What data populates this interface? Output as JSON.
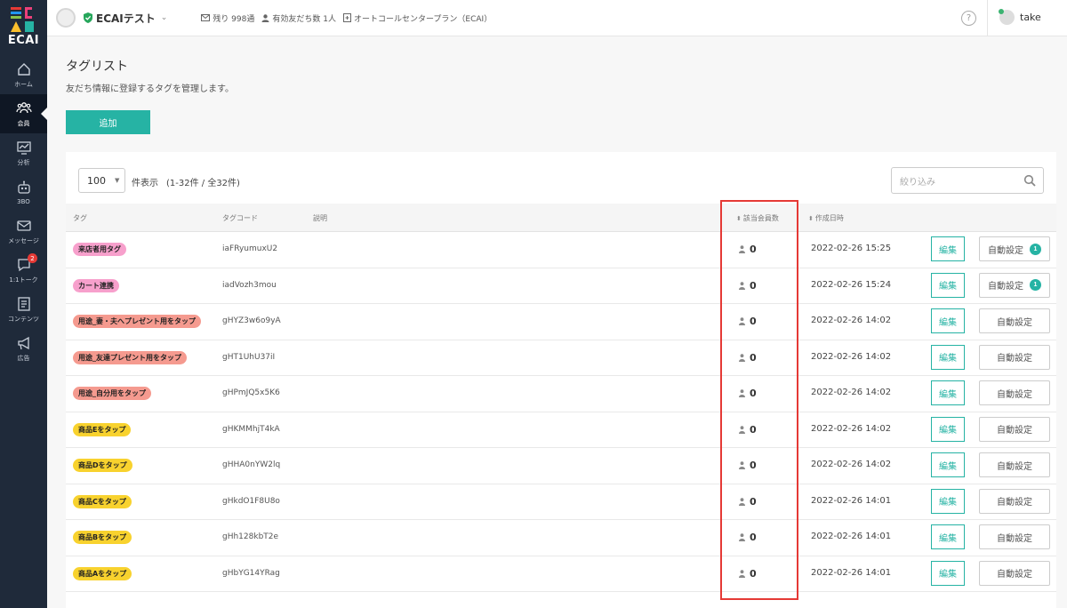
{
  "brand": {
    "logo_text": "ECAI",
    "colors": {
      "teal": "#26b3a4",
      "sidebar": "#1f2a3a",
      "highlight": "#e53935"
    }
  },
  "sidebar": {
    "items": [
      {
        "label": "ホーム",
        "icon": "home-icon"
      },
      {
        "label": "会員",
        "icon": "members-icon",
        "active": true
      },
      {
        "label": "分析",
        "icon": "analytics-icon"
      },
      {
        "label": "3BO",
        "icon": "robot-icon"
      },
      {
        "label": "メッセージ",
        "icon": "message-icon"
      },
      {
        "label": "1:1トーク",
        "icon": "chat-icon",
        "badge": "2"
      },
      {
        "label": "コンテンツ",
        "icon": "content-icon"
      },
      {
        "label": "広告",
        "icon": "megaphone-icon"
      }
    ]
  },
  "header": {
    "account_name": "ECAIテスト",
    "remaining": "残り 998通",
    "friends": "有効友だち数 1人",
    "plan": "オートコールセンタープラン（ECAI）",
    "help": "?",
    "user_name": "take"
  },
  "page": {
    "title": "タグリスト",
    "description": "友だち情報に登録するタグを管理します。",
    "add_label": "追加"
  },
  "table": {
    "per_page": "100",
    "per_page_label": "件表示",
    "count_label": "(1-32件 / 全32件)",
    "search_placeholder": "絞り込み",
    "headers": {
      "tag": "タグ",
      "code": "タグコード",
      "desc": "説明",
      "members": "該当会員数",
      "created": "作成日時"
    },
    "edit_label": "編集",
    "auto_label": "自動設定",
    "rows": [
      {
        "tag": "来店者用タグ",
        "color": "#f7a0cc",
        "code": "iaFRyumuxU2",
        "members": "0",
        "date": "2022-02-26 15:25",
        "auto_badge": "1"
      },
      {
        "tag": "カート連携",
        "color": "#f7a0cc",
        "code": "iadVozh3mou",
        "members": "0",
        "date": "2022-02-26 15:24",
        "auto_badge": "1"
      },
      {
        "tag": "用途_妻・夫へプレゼント用をタップ",
        "color": "#f59a8f",
        "code": "gHYZ3w6o9yA",
        "members": "0",
        "date": "2022-02-26 14:02"
      },
      {
        "tag": "用途_友達プレゼント用をタップ",
        "color": "#f59a8f",
        "code": "gHT1UhU37iI",
        "members": "0",
        "date": "2022-02-26 14:02"
      },
      {
        "tag": "用途_自分用をタップ",
        "color": "#f59a8f",
        "code": "gHPmJQ5x5K6",
        "members": "0",
        "date": "2022-02-26 14:02"
      },
      {
        "tag": "商品Eをタップ",
        "color": "#f8d22e",
        "code": "gHKMMhjT4kA",
        "members": "0",
        "date": "2022-02-26 14:02"
      },
      {
        "tag": "商品Dをタップ",
        "color": "#f8d22e",
        "code": "gHHA0nYW2lq",
        "members": "0",
        "date": "2022-02-26 14:02"
      },
      {
        "tag": "商品Cをタップ",
        "color": "#f8d22e",
        "code": "gHkdO1F8U8o",
        "members": "0",
        "date": "2022-02-26 14:01"
      },
      {
        "tag": "商品Bをタップ",
        "color": "#f8d22e",
        "code": "gHh128kbT2e",
        "members": "0",
        "date": "2022-02-26 14:01"
      },
      {
        "tag": "商品Aをタップ",
        "color": "#f8d22e",
        "code": "gHbYG14YRag",
        "members": "0",
        "date": "2022-02-26 14:01"
      }
    ]
  }
}
